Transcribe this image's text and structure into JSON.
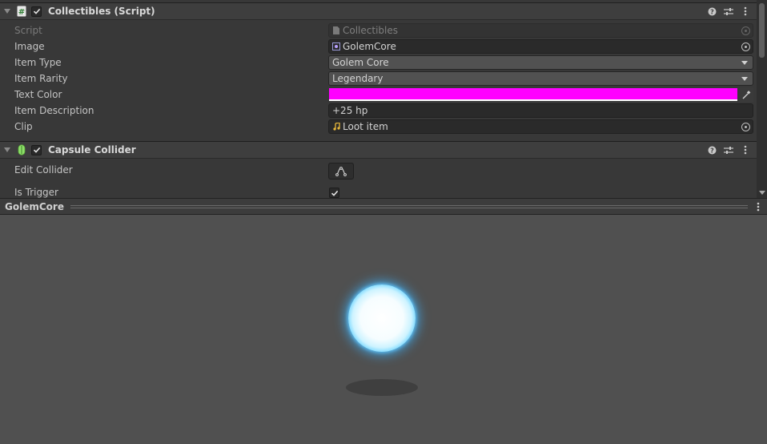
{
  "collectibles_component": {
    "title": "Collectibles (Script)",
    "enabled": true,
    "icon": "script-hash-icon",
    "properties": {
      "script": {
        "label": "Script",
        "value": "Collectibles"
      },
      "image": {
        "label": "Image",
        "value": "GolemCore"
      },
      "item_type": {
        "label": "Item Type",
        "value": "Golem Core"
      },
      "item_rarity": {
        "label": "Item Rarity",
        "value": "Legendary"
      },
      "text_color": {
        "label": "Text Color",
        "value": "#ff00ff"
      },
      "item_description": {
        "label": "Item Description",
        "value": "+25 hp"
      },
      "clip": {
        "label": "Clip",
        "value": "Loot item"
      }
    }
  },
  "capsule_collider_component": {
    "title": "Capsule Collider",
    "enabled": true,
    "icon": "capsule-collider-icon",
    "properties": {
      "edit_collider": {
        "label": "Edit Collider"
      },
      "is_trigger": {
        "label": "Is Trigger",
        "checked": true
      }
    }
  },
  "preview": {
    "title": "GolemCore"
  },
  "colors": {
    "accent_text_color": "#ff00ff",
    "orb_glow": "#3cb4ff"
  }
}
